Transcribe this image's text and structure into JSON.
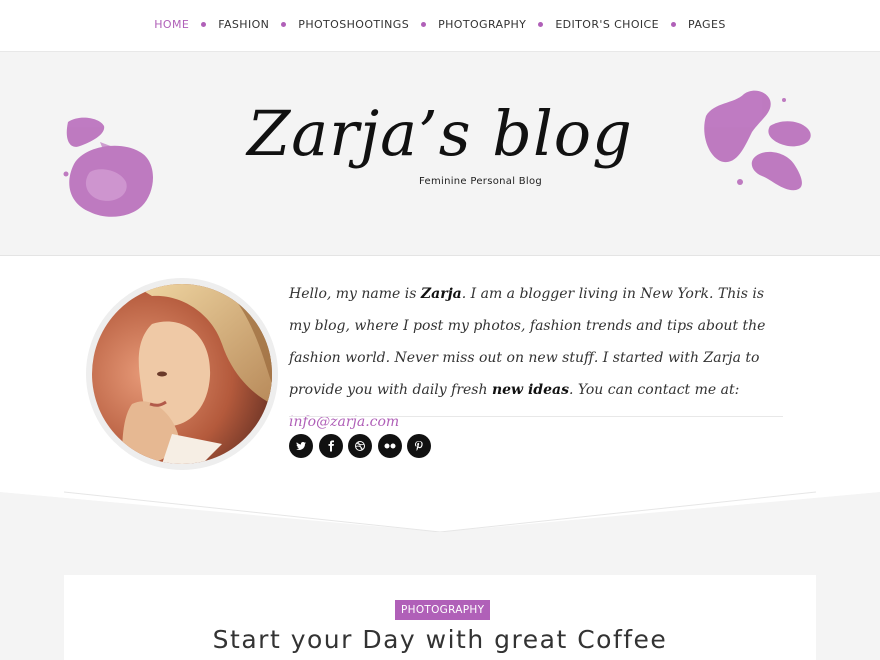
{
  "nav": {
    "items": [
      {
        "label": "HOME",
        "active": true
      },
      {
        "label": "FASHION"
      },
      {
        "label": "PHOTOSHOOTINGS"
      },
      {
        "label": "PHOTOGRAPHY"
      },
      {
        "label": "EDITOR'S CHOICE"
      },
      {
        "label": "PAGES"
      }
    ]
  },
  "header": {
    "title": "Zarja’s blog",
    "tagline": "Feminine Personal Blog"
  },
  "about": {
    "text_1": "Hello, my name is ",
    "name": "Zarja",
    "text_2": ". I am a blogger living in New York. This is my blog, where I post my photos, fashion trends and tips about the fashion world. Never miss out on new stuff. I started with Zarja to provide you with daily fresh ",
    "highlight": "new ideas",
    "text_3": ". You can contact me at: ",
    "email": "info@zarja.com",
    "socials": [
      "twitter-icon",
      "facebook-icon",
      "dribbble-icon",
      "flickr-icon",
      "pinterest-icon"
    ]
  },
  "post": {
    "category": "PHOTOGRAPHY",
    "title": "Start your Day with great Coffee"
  },
  "colors": {
    "accent": "#b060b8",
    "background": "#f4f4f4"
  }
}
